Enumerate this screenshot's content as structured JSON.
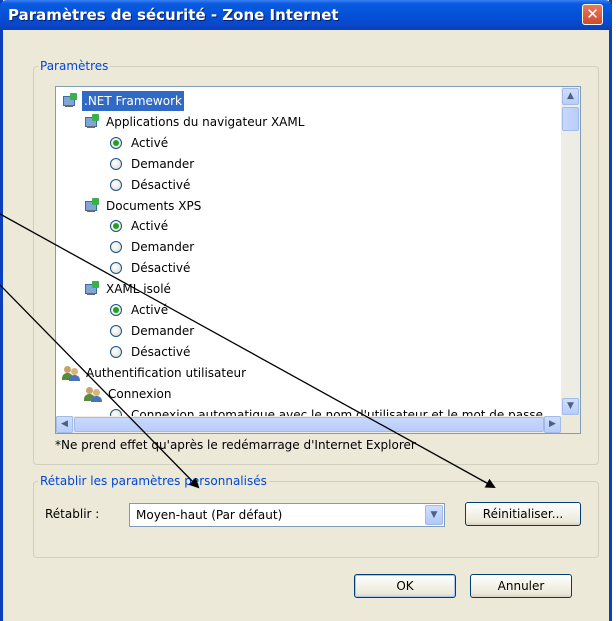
{
  "window": {
    "title": "Paramètres de sécurité - Zone Internet",
    "close_glyph": "✕"
  },
  "settings_group": {
    "legend": "Paramètres",
    "tree": [
      {
        "type": "node",
        "icon": "network-settings-icon",
        "label": ".NET Framework",
        "level": 0,
        "selected": true
      },
      {
        "type": "node",
        "icon": "network-settings-icon",
        "label": "Applications du navigateur XAML",
        "level": 1
      },
      {
        "type": "option",
        "label": "Activé",
        "checked": true
      },
      {
        "type": "option",
        "label": "Demander",
        "checked": false
      },
      {
        "type": "option",
        "label": "Désactivé",
        "checked": false
      },
      {
        "type": "node",
        "icon": "network-settings-icon",
        "label": "Documents XPS",
        "level": 1
      },
      {
        "type": "option",
        "label": "Activé",
        "checked": true
      },
      {
        "type": "option",
        "label": "Demander",
        "checked": false
      },
      {
        "type": "option",
        "label": "Désactivé",
        "checked": false
      },
      {
        "type": "node",
        "icon": "network-settings-icon",
        "label": "XAML isolé",
        "level": 1
      },
      {
        "type": "option",
        "label": "Activé",
        "checked": true
      },
      {
        "type": "option",
        "label": "Demander",
        "checked": false
      },
      {
        "type": "option",
        "label": "Désactivé",
        "checked": false
      },
      {
        "type": "node",
        "icon": "users-icon",
        "label": "Authentification utilisateur",
        "level": 0
      },
      {
        "type": "node",
        "icon": "users-icon",
        "label": "Connexion",
        "level": 1
      },
      {
        "type": "option",
        "label": "Connexion automatique avec le nom d'utilisateur et le mot de passe",
        "checked": false
      }
    ],
    "note": "*Ne prend effet qu'après le redémarrage d'Internet Explorer"
  },
  "reset_group": {
    "legend": "Rétablir les paramètres personnalisés",
    "reset_label": "Rétablir :",
    "select_value": "Moyen-haut (Par défaut)",
    "reset_button": "Réinitialiser..."
  },
  "footer": {
    "ok_button": "OK",
    "cancel_button": "Annuler"
  },
  "colors": {
    "title_bar": "#0a5be0",
    "dialog_bg": "#ece9d8",
    "selection": "#316ac5",
    "legend_text": "#0046d5"
  }
}
